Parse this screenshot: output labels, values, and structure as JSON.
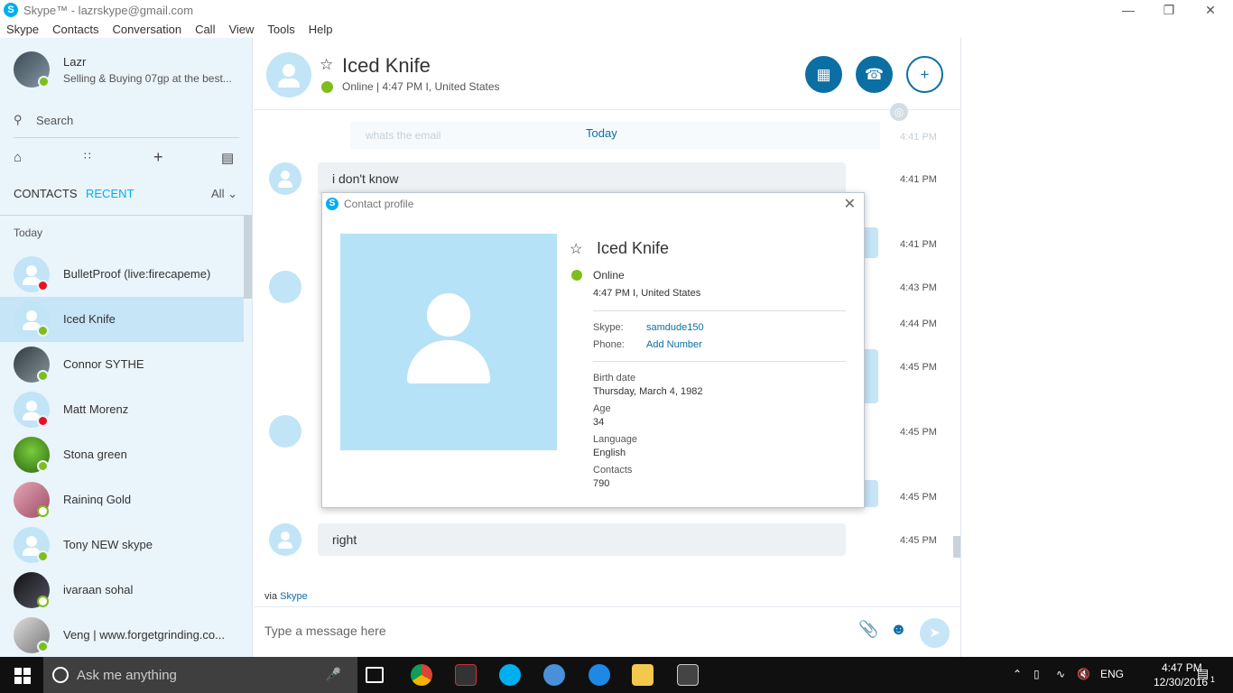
{
  "window": {
    "title": "Skype™ - lazrskype@gmail.com",
    "minimize": "—",
    "restore": "❐",
    "close": "✕"
  },
  "menu": [
    "Skype",
    "Contacts",
    "Conversation",
    "Call",
    "View",
    "Tools",
    "Help"
  ],
  "profile": {
    "name": "Lazr",
    "mood": "Selling & Buying 07gp at the best..."
  },
  "search": {
    "label": "Search"
  },
  "tabs": {
    "contacts": "CONTACTS",
    "recent": "RECENT",
    "filter": "All"
  },
  "day_label": "Today",
  "contacts": [
    {
      "name": "BulletProof (live:firecapeme)",
      "status": "busy"
    },
    {
      "name": "Iced Knife",
      "status": "online",
      "selected": true
    },
    {
      "name": "Connor SYTHE",
      "status": "online"
    },
    {
      "name": "Matt Morenz",
      "status": "busy"
    },
    {
      "name": "Stona green",
      "status": "online"
    },
    {
      "name": "Raininq Gold",
      "status": "away"
    },
    {
      "name": "Tony NEW skype",
      "status": "online"
    },
    {
      "name": "ivaraan sohal",
      "status": "away"
    },
    {
      "name": "Veng | www.forgetgrinding.co...",
      "status": "online"
    }
  ],
  "chat": {
    "contact_name": "Iced Knife",
    "status_line": "Online  |  4:47 PM I, United States",
    "today_label": "Today",
    "faded_text": "whats the email",
    "faded_time": "4:41 PM",
    "messages": [
      {
        "text": "i don't know",
        "time": "4:41 PM"
      },
      {
        "text": "",
        "time": "4:41 PM"
      },
      {
        "text": "",
        "time": "4:43 PM"
      },
      {
        "text": "",
        "time": "4:44 PM"
      },
      {
        "text": "",
        "time": "4:45 PM"
      },
      {
        "text": "",
        "time": "4:45 PM"
      },
      {
        "text": "",
        "time": "4:45 PM"
      },
      {
        "text": "right",
        "time": "4:45 PM"
      }
    ],
    "via_prefix": "via",
    "via_link": "Skype",
    "composer_placeholder": "Type a message here"
  },
  "dialog": {
    "title": "Contact profile",
    "name": "Iced Knife",
    "status": "Online",
    "local_time": "4:47 PM I, United States",
    "skype_label": "Skype:",
    "skype_value": "samdude150",
    "phone_label": "Phone:",
    "phone_value": "Add Number",
    "birth_label": "Birth date",
    "birth_value": "Thursday, March 4, 1982",
    "age_label": "Age",
    "age_value": "34",
    "language_label": "Language",
    "language_value": "English",
    "contacts_label": "Contacts",
    "contacts_value": "790"
  },
  "taskbar": {
    "search_text": "Ask me anything",
    "lang": "ENG",
    "time": "4:47 PM",
    "date": "12/30/2016",
    "notif_count": "1"
  },
  "colors": {
    "accent": "#00aff0",
    "dark_blue": "#0c6fa4",
    "online": "#7dbe1c",
    "busy": "#e81123",
    "sidebar_bg": "#eaf4fb"
  }
}
